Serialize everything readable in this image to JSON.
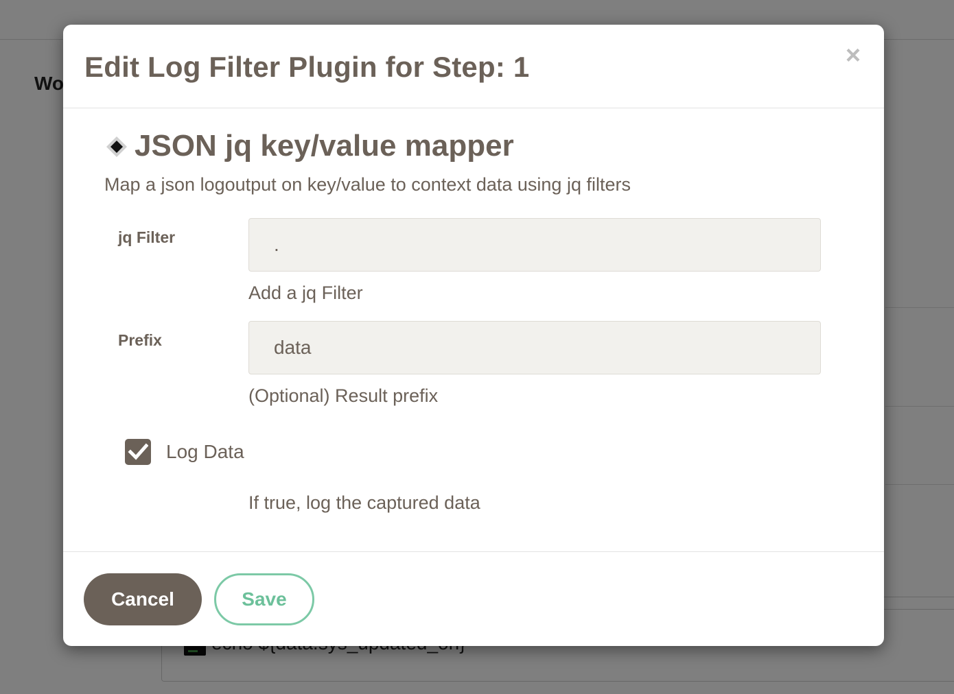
{
  "background": {
    "heading": "Wo",
    "step_command": "echo ${data.sys_updated_on}"
  },
  "modal": {
    "title": "Edit Log Filter Plugin for Step: 1",
    "close_glyph": "×",
    "plugin": {
      "icon": "diamond-icon",
      "name": "JSON jq key/value mapper",
      "description": "Map a json logoutput on key/value to context data using jq filters"
    },
    "fields": {
      "jq_filter": {
        "label": "jq Filter",
        "value": ".",
        "help": "Add a jq Filter"
      },
      "prefix": {
        "label": "Prefix",
        "value": "data",
        "help": "(Optional) Result prefix"
      },
      "log_data": {
        "label": "Log Data",
        "checked": true,
        "help": "If true, log the captured data"
      }
    },
    "footer": {
      "cancel_label": "Cancel",
      "save_label": "Save"
    }
  },
  "colors": {
    "text": "#6b6158",
    "input_bg": "#f2f1ed",
    "save_accent": "#6cc09a",
    "cancel_bg": "#6b6158",
    "close_icon": "#bdbdbd"
  }
}
